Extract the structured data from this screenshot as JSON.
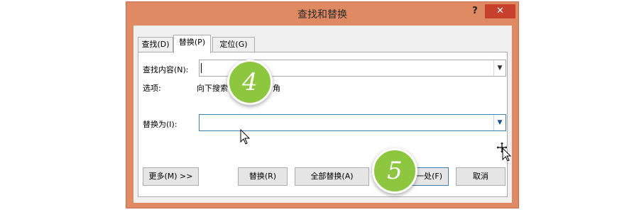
{
  "window": {
    "title": "查找和替换",
    "help_label": "?",
    "close_label": "✕",
    "colors": {
      "titlebar": "#df8a62",
      "close": "#c7402c",
      "client": "#f0f0f0",
      "badge": "#8dc63f"
    }
  },
  "tabs": [
    {
      "label": "查找(D)",
      "active": false
    },
    {
      "label": "替换(P)",
      "active": true
    },
    {
      "label": "定位(G)",
      "active": false
    }
  ],
  "find": {
    "label": "查找内容(N):",
    "value": ""
  },
  "options": {
    "label": "选项:",
    "value_left": "向下搜索",
    "value_right": "角"
  },
  "replace": {
    "label": "替换为(I):",
    "value": ""
  },
  "buttons": {
    "more": "更多(M) >>",
    "replace": "替换(R)",
    "replace_all": "全部替换(A)",
    "find_next": "一处(F)",
    "cancel": "取消"
  },
  "badges": {
    "step4": "4",
    "step5": "5"
  },
  "icons": [
    "dropdown-arrow-icon",
    "mouse-pointer-icon",
    "move-cursor-icon"
  ]
}
